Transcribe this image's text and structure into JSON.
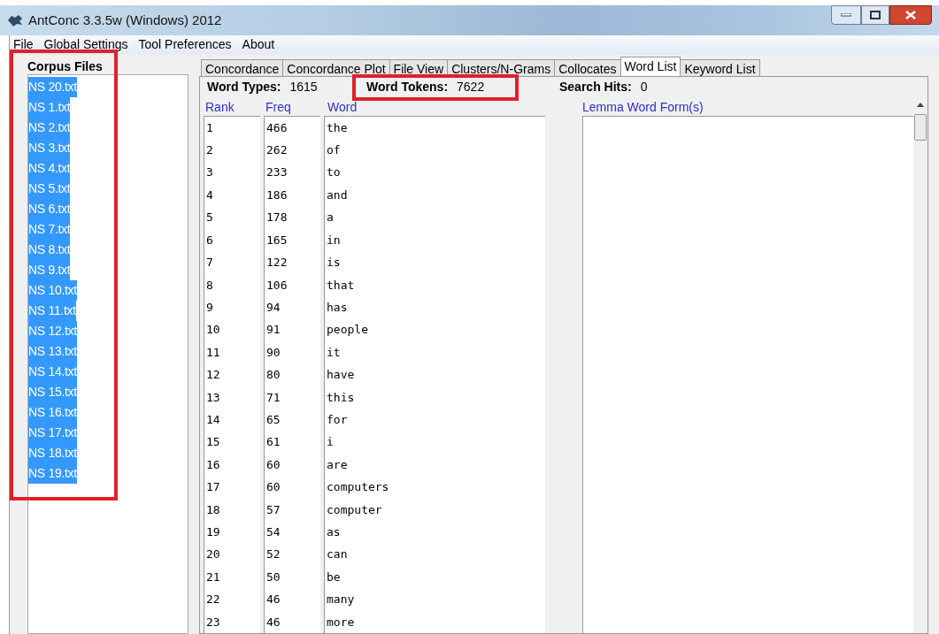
{
  "window": {
    "title": "AntConc 3.3.5w (Windows) 2012"
  },
  "menu": [
    "File",
    "Global Settings",
    "Tool Preferences",
    "About"
  ],
  "corpus_files": {
    "title": "Corpus Files",
    "files": [
      {
        "name": "NS 20.txt",
        "selected": true
      },
      {
        "name": "NS 1.txt",
        "selected": true
      },
      {
        "name": "NS 2.txt",
        "selected": true
      },
      {
        "name": "NS 3.txt",
        "selected": true
      },
      {
        "name": "NS 4.txt",
        "selected": true
      },
      {
        "name": "NS 5.txt",
        "selected": true
      },
      {
        "name": "NS 6.txt",
        "selected": true
      },
      {
        "name": "NS 7.txt",
        "selected": true
      },
      {
        "name": "NS 8.txt",
        "selected": true
      },
      {
        "name": "NS 9.txt",
        "selected": true
      },
      {
        "name": "NS 10.txt",
        "selected": true
      },
      {
        "name": "NS 11.txt",
        "selected": true
      },
      {
        "name": "NS 12.txt",
        "selected": true
      },
      {
        "name": "NS 13.txt",
        "selected": true
      },
      {
        "name": "NS 14.txt",
        "selected": true
      },
      {
        "name": "NS 15.txt",
        "selected": true
      },
      {
        "name": "NS 16.txt",
        "selected": true
      },
      {
        "name": "NS 17.txt",
        "selected": true
      },
      {
        "name": "NS 18.txt",
        "selected": true
      },
      {
        "name": "NS 19.txt",
        "selected": true
      }
    ]
  },
  "tabs": [
    {
      "label": "Concordance",
      "selected": false
    },
    {
      "label": "Concordance Plot",
      "selected": false
    },
    {
      "label": "File View",
      "selected": false
    },
    {
      "label": "Clusters/N-Grams",
      "selected": false
    },
    {
      "label": "Collocates",
      "selected": false
    },
    {
      "label": "Word List",
      "selected": true
    },
    {
      "label": "Keyword List",
      "selected": false
    }
  ],
  "stats": [
    {
      "label": "Word Types:",
      "value": "1615",
      "highlighted": false
    },
    {
      "label": "Word Tokens:",
      "value": "7622",
      "highlighted": true
    },
    {
      "label": "Search Hits:",
      "value": "0",
      "highlighted": false
    }
  ],
  "table": {
    "columns": [
      "Rank",
      "Freq",
      "Word"
    ],
    "lemma_column": "Lemma Word Form(s)",
    "rows": [
      [
        "1",
        "466",
        "the"
      ],
      [
        "2",
        "262",
        "of"
      ],
      [
        "3",
        "233",
        "to"
      ],
      [
        "4",
        "186",
        "and"
      ],
      [
        "5",
        "178",
        "a"
      ],
      [
        "6",
        "165",
        "in"
      ],
      [
        "7",
        "122",
        "is"
      ],
      [
        "8",
        "106",
        "that"
      ],
      [
        "9",
        "94",
        "has"
      ],
      [
        "10",
        "91",
        "people"
      ],
      [
        "11",
        "90",
        "it"
      ],
      [
        "12",
        "80",
        "have"
      ],
      [
        "13",
        "71",
        "this"
      ],
      [
        "14",
        "65",
        "for"
      ],
      [
        "15",
        "61",
        "i"
      ],
      [
        "16",
        "60",
        "are"
      ],
      [
        "17",
        "60",
        "computers"
      ],
      [
        "18",
        "57",
        "computer"
      ],
      [
        "19",
        "54",
        "as"
      ],
      [
        "20",
        "52",
        "can"
      ],
      [
        "21",
        "50",
        "be"
      ],
      [
        "22",
        "46",
        "many"
      ],
      [
        "23",
        "46",
        "more"
      ]
    ]
  }
}
